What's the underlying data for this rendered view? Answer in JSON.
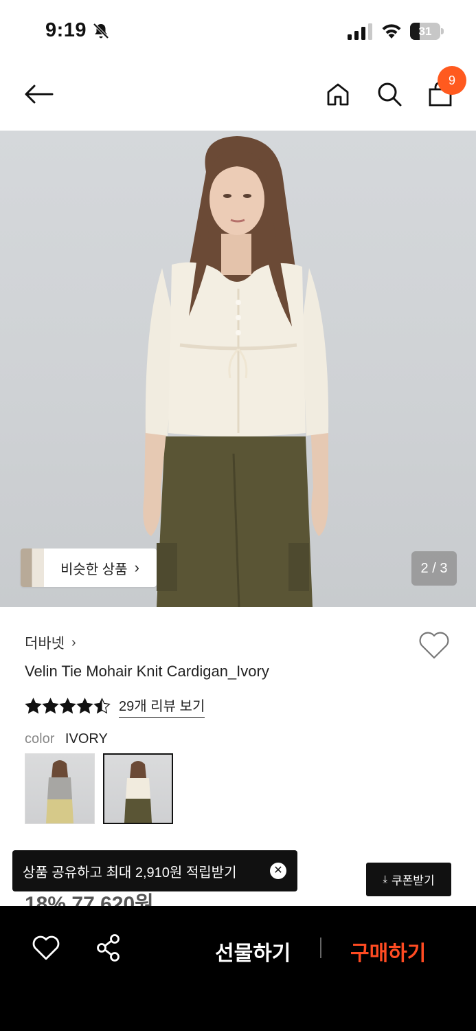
{
  "status_bar": {
    "time": "9:19",
    "battery": "31",
    "battery_level": 0.31
  },
  "nav": {
    "cart_count": "9"
  },
  "gallery": {
    "similar_label": "비슷한 상품",
    "page_indicator": "2 / 3"
  },
  "product": {
    "brand": "더바넷",
    "name": "Velin Tie Mohair Knit Cardigan_Ivory",
    "rating": 4.5,
    "review_link": "29개 리뷰 보기",
    "color_label": "color",
    "color_value": "IVORY",
    "price_partial": "18% 77,620원"
  },
  "toast": {
    "text": "상품 공유하고 최대 2,910원 적립받기"
  },
  "coupon": {
    "label": "쿠폰받기"
  },
  "bottom_bar": {
    "gift_label": "선물하기",
    "buy_label": "구매하기"
  },
  "colors": {
    "accent": "#ff5a1f",
    "buy": "#ff4b22",
    "badge": "#ff5a1f"
  }
}
